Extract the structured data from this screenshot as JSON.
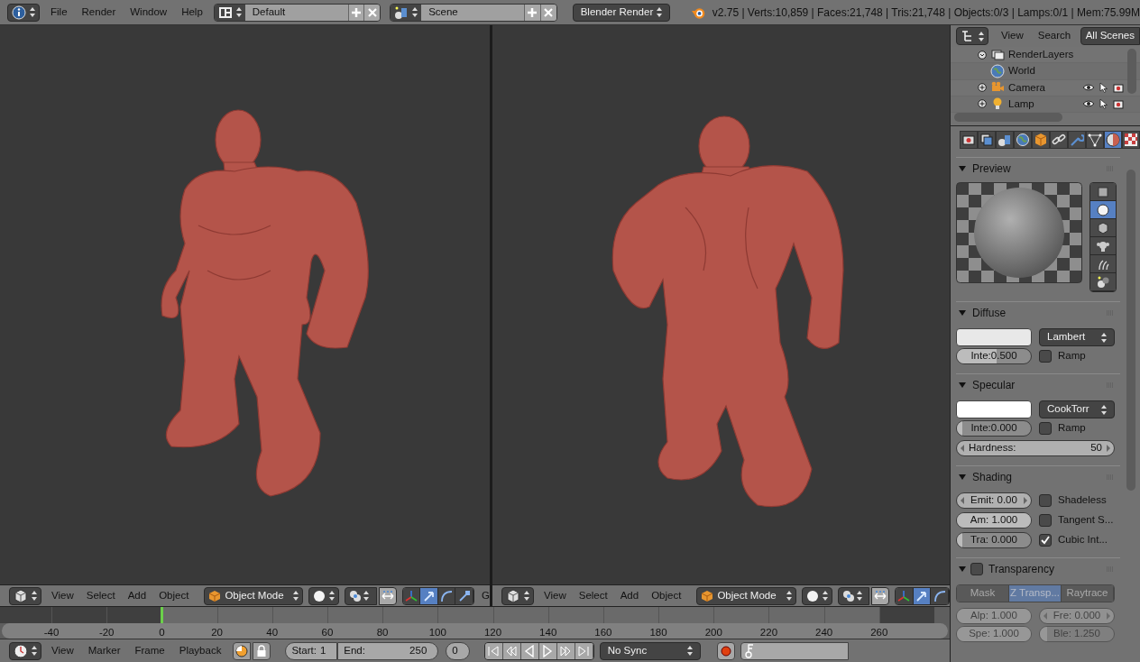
{
  "top_bar": {
    "menus": [
      "File",
      "Render",
      "Window",
      "Help"
    ],
    "screen_layout": "Default",
    "scene": "Scene",
    "render_engine": "Blender Render",
    "stats": "v2.75 | Verts:10,859 | Faces:21,748 | Tris:21,748 | Objects:0/3 | Lamps:0/1 | Mem:75.99M"
  },
  "viewports": [
    {
      "header": {
        "menus": [
          "View",
          "Select",
          "Add",
          "Object"
        ],
        "mode": "Object Mode",
        "manipulators": [
          {
            "kind": "axes",
            "selected": false
          },
          {
            "kind": "translate",
            "selected": true
          },
          {
            "kind": "rotate",
            "selected": false
          },
          {
            "kind": "scale",
            "selected": false
          }
        ],
        "overflow_text": "G"
      }
    },
    {
      "header": {
        "menus": [
          "View",
          "Select",
          "Add",
          "Object"
        ],
        "mode": "Object Mode",
        "manipulators": [
          {
            "kind": "axes",
            "selected": false
          },
          {
            "kind": "translate",
            "selected": true
          },
          {
            "kind": "rotate",
            "selected": false
          }
        ]
      }
    }
  ],
  "outliner": {
    "menus": [
      "View",
      "Search"
    ],
    "filter": "All Scenes",
    "items": [
      {
        "label": "RenderLayers",
        "kind": "renderlayers",
        "expanded": true
      },
      {
        "label": "World",
        "kind": "world"
      },
      {
        "label": "Camera",
        "kind": "camera",
        "expanded": false
      },
      {
        "label": "Lamp",
        "kind": "lamp",
        "expanded": false
      }
    ]
  },
  "properties": {
    "tabs": [
      {
        "kind": "render",
        "selected": false
      },
      {
        "kind": "layers",
        "selected": false
      },
      {
        "kind": "scene",
        "selected": false
      },
      {
        "kind": "world",
        "selected": false
      },
      {
        "kind": "object",
        "selected": false
      },
      {
        "kind": "constraints",
        "selected": false
      },
      {
        "kind": "modifiers",
        "selected": false
      },
      {
        "kind": "data",
        "selected": false
      },
      {
        "kind": "material",
        "selected": true
      },
      {
        "kind": "texture",
        "selected": false
      }
    ],
    "preview": {
      "title": "Preview",
      "shapes": [
        {
          "kind": "flat",
          "selected": false
        },
        {
          "kind": "sphere",
          "selected": true
        },
        {
          "kind": "cube",
          "selected": false
        },
        {
          "kind": "monkey",
          "selected": false
        },
        {
          "kind": "hair",
          "selected": false
        },
        {
          "kind": "sky",
          "selected": false
        }
      ]
    },
    "diffuse": {
      "title": "Diffuse",
      "color": "#e8e8e8",
      "shader": "Lambert",
      "intensity": {
        "label": "Inte:0.500",
        "level": 0.5
      },
      "ramp": {
        "label": "Ramp",
        "checked": false
      }
    },
    "specular": {
      "title": "Specular",
      "color": "#ffffff",
      "shader": "CookTorr",
      "intensity": {
        "label": "Inte:0.000",
        "level": 0
      },
      "ramp": {
        "label": "Ramp",
        "checked": false
      },
      "hardness": {
        "label": "Hardness:",
        "value": "50"
      }
    },
    "shading": {
      "title": "Shading",
      "fields": [
        {
          "label": "Emit: 0.00",
          "kind": "number"
        },
        {
          "label": "Am: 1.000",
          "kind": "slider",
          "level": 1
        },
        {
          "label": "Tra: 0.000",
          "kind": "slider",
          "level": 0
        }
      ],
      "options": [
        {
          "label": "Shadeless",
          "checked": false
        },
        {
          "label": "Tangent S...",
          "checked": false
        },
        {
          "label": "Cubic Int...",
          "checked": true
        }
      ]
    },
    "transparency": {
      "title": "Transparency",
      "enabled": false,
      "methods": [
        {
          "label": "Mask",
          "selected": false
        },
        {
          "label": "Z Transp...",
          "selected": true
        },
        {
          "label": "Raytrace",
          "selected": false
        }
      ],
      "fields": [
        {
          "label": "Alp: 1.000",
          "kind": "slider",
          "level": 1
        },
        {
          "label": "Fre: 0.000",
          "kind": "number"
        },
        {
          "label": "Spe: 1.000",
          "kind": "slider",
          "level": 1
        },
        {
          "label": "Ble: 1.250",
          "kind": "slider",
          "level": 0.02
        }
      ]
    }
  },
  "timeline": {
    "ruler_labels": [
      {
        "text": "-40",
        "current": false,
        "in_range": false
      },
      {
        "text": "-20",
        "current": false,
        "in_range": false
      },
      {
        "text": "0",
        "current": true,
        "in_range": true
      },
      {
        "text": "20",
        "current": false,
        "in_range": true
      },
      {
        "text": "40",
        "current": false,
        "in_range": true
      },
      {
        "text": "60",
        "current": false,
        "in_range": true
      },
      {
        "text": "80",
        "current": false,
        "in_range": true
      },
      {
        "text": "100",
        "current": false,
        "in_range": true
      },
      {
        "text": "120",
        "current": false,
        "in_range": true
      },
      {
        "text": "140",
        "current": false,
        "in_range": true
      },
      {
        "text": "160",
        "current": false,
        "in_range": true
      },
      {
        "text": "180",
        "current": false,
        "in_range": true
      },
      {
        "text": "200",
        "current": false,
        "in_range": true
      },
      {
        "text": "220",
        "current": false,
        "in_range": true
      },
      {
        "text": "240",
        "current": false,
        "in_range": true
      },
      {
        "text": "260",
        "current": false,
        "in_range": false
      }
    ],
    "header": {
      "menus": [
        "View",
        "Marker",
        "Frame",
        "Playback"
      ],
      "start": {
        "label": "Start:",
        "value": "1"
      },
      "end": {
        "label": "End:",
        "value": "250"
      },
      "current_frame": "0",
      "sync": "No Sync"
    }
  }
}
